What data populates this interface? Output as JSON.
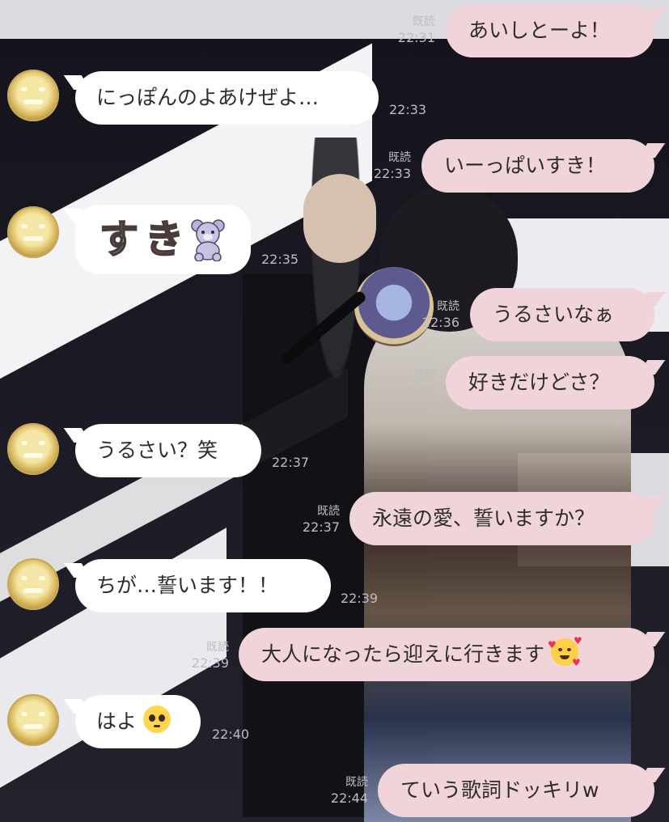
{
  "colors": {
    "outgoing_bubble": "#f1d4d9",
    "incoming_bubble": "#ffffff",
    "meta_text": "#bdbcc2"
  },
  "messages": [
    {
      "dir": "out",
      "text": "あいしとーよ！",
      "read": "既読",
      "time": "22:31"
    },
    {
      "dir": "in",
      "text": "にっぽんのよあけぜよ…",
      "time": "22:33",
      "avatar": "round-face-avatar-icon"
    },
    {
      "dir": "out",
      "text": "いーっぱいすき！",
      "read": "既読",
      "time": "22:33"
    },
    {
      "dir": "in",
      "type": "sticker",
      "sticker_chars": [
        "す",
        "き"
      ],
      "sticker_icon": "teddy-bear-icon",
      "time": "22:35",
      "avatar": "round-face-avatar-icon"
    },
    {
      "dir": "out",
      "text": "うるさいなぁ",
      "read": "既読",
      "time": "22:36"
    },
    {
      "dir": "out",
      "text": "好きだけどさ？",
      "read": "既読",
      "time": "22:36"
    },
    {
      "dir": "in",
      "text": "うるさい？笑",
      "time": "22:37",
      "avatar": "round-face-avatar-icon"
    },
    {
      "dir": "out",
      "text": "永遠の愛、誓いますか？",
      "read": "既読",
      "time": "22:37"
    },
    {
      "dir": "in",
      "text": "ちが…誓います！！",
      "time": "22:39",
      "avatar": "round-face-avatar-icon"
    },
    {
      "dir": "out",
      "text": "大人になったら迎えに行きます",
      "emoji": "smiling-face-with-hearts-icon",
      "read": "既読",
      "time": "22:39"
    },
    {
      "dir": "in",
      "text": "はよ",
      "emoji": "pleading-face-icon",
      "time": "22:40",
      "avatar": "round-face-avatar-icon"
    },
    {
      "dir": "out",
      "text": "ていう歌詞ドッキリw",
      "read": "既読",
      "time": "22:44"
    }
  ]
}
